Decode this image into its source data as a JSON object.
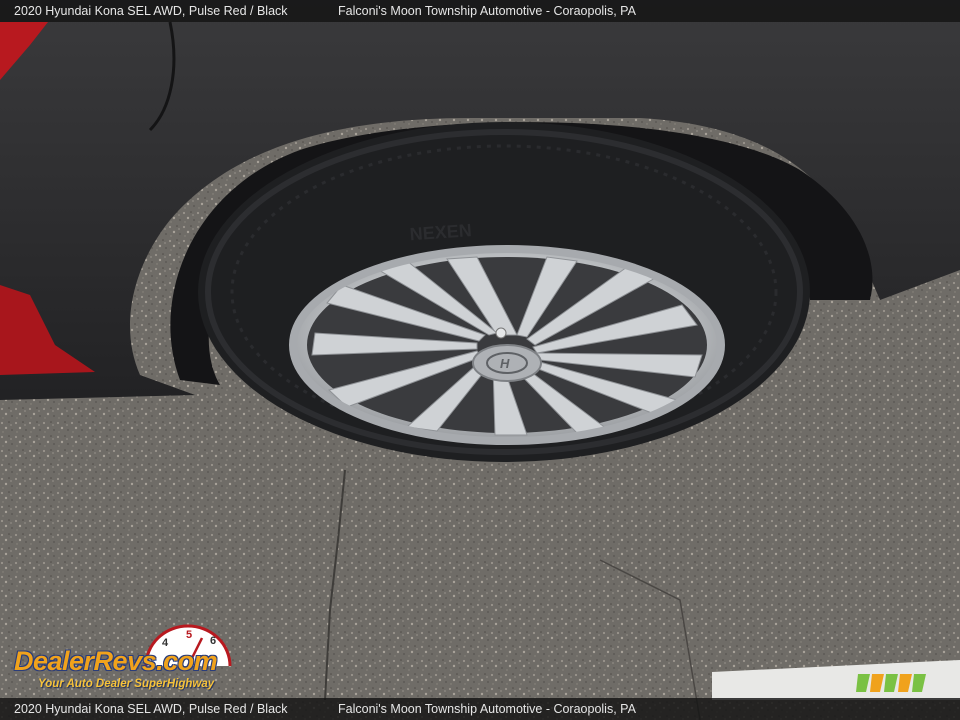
{
  "caption": {
    "vehicle": "2020 Hyundai Kona SEL AWD,  Pulse Red / Black",
    "dealer": "Falconi's Moon Township Automotive - Coraopolis, PA"
  },
  "watermark": {
    "brand": "DealerRevs.com",
    "tagline": "Your Auto Dealer SuperHighway"
  },
  "colors": {
    "body_red": "#b8191f",
    "cladding": "#2b2b2d",
    "tire": "#1e1f21",
    "wheel_silver": "#c2c5c8",
    "pavement": "#6e6b66",
    "bar": "#141414",
    "logo_orange": "#f0a21c",
    "logo_blue": "#2a3d7a"
  },
  "icons": [
    "dealerrevs-logo",
    "dealer-badge-logo",
    "hyundai-hub-emblem"
  ]
}
